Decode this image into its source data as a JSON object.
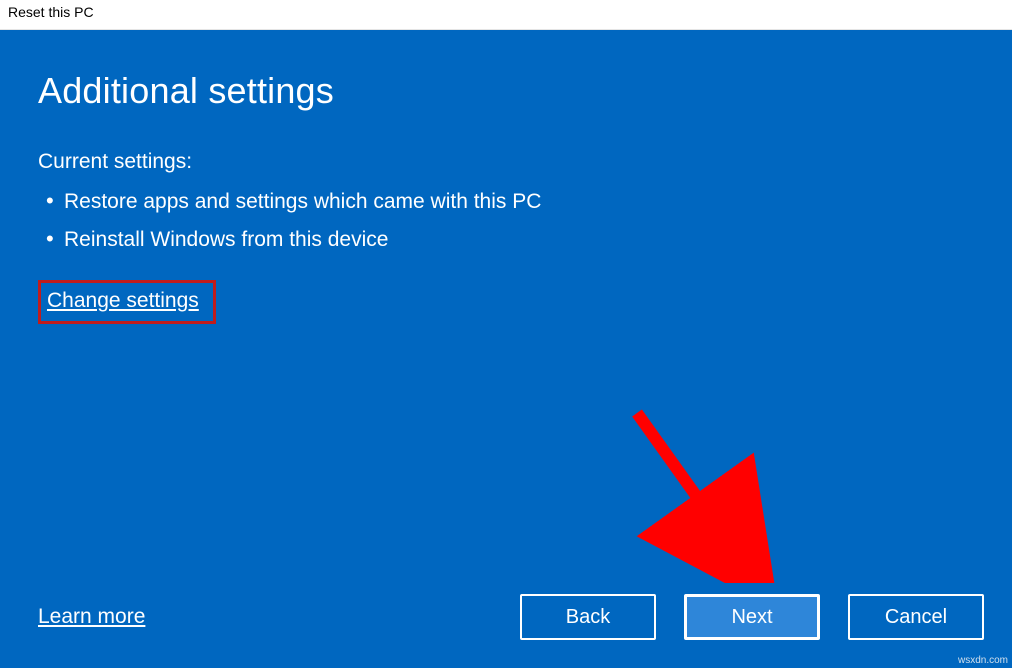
{
  "window": {
    "title": "Reset this PC"
  },
  "page": {
    "heading": "Additional settings",
    "subheading": "Current settings:",
    "settings": [
      "Restore apps and settings which came with this PC",
      "Reinstall Windows from this device"
    ],
    "change_settings_label": "Change settings"
  },
  "footer": {
    "learn_more_label": "Learn more",
    "buttons": {
      "back": "Back",
      "next": "Next",
      "cancel": "Cancel"
    }
  },
  "watermark": "wsxdn.com"
}
